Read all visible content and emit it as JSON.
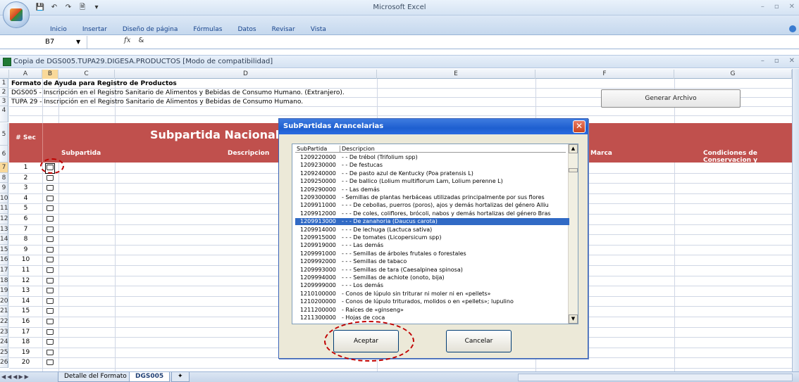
{
  "app_title": "Microsoft Excel",
  "ribbon_tabs": [
    "Inicio",
    "Insertar",
    "Diseño de página",
    "Fórmulas",
    "Datos",
    "Revisar",
    "Vista"
  ],
  "formula_bar": {
    "name_box": "B7",
    "fx": "fx",
    "value": "&"
  },
  "workbook_title": "Copia de DGS005.TUPA29.DIGESA.PRODUCTOS  [Modo de compatibilidad]",
  "columns": [
    "A",
    "B",
    "C",
    "D",
    "E",
    "F",
    "G"
  ],
  "rows": {
    "r1": "Formato de Ayuda para Registro de Productos",
    "r2": "DGS005 - Inscripción en el Registro Sanitario de Alimentos y Bebidas de Consumo Humano. (Extranjero).",
    "r3": "TUPA 29 - Inscripción en el Registro Sanitario de Alimentos y Bebidas de Consumo Humano."
  },
  "generate_button": "Generar Archivo",
  "table_header": {
    "sec": "# Sec",
    "main_title": "Subpartida Nacional",
    "subpartida": "Subpartida",
    "descripcion": "Descripcion",
    "marca": "Marca",
    "condiciones": "Condiciones de Conservacion y"
  },
  "row_numbers": [
    "1",
    "2",
    "3",
    "4",
    "5",
    "6",
    "7",
    "8",
    "9",
    "10",
    "11",
    "12",
    "13",
    "14",
    "15",
    "16",
    "17",
    "18",
    "19",
    "20",
    "21",
    "22",
    "23",
    "24",
    "25",
    "26"
  ],
  "sec_numbers": [
    "1",
    "2",
    "3",
    "4",
    "5",
    "6",
    "7",
    "8",
    "9",
    "10",
    "11",
    "12",
    "13",
    "14",
    "15",
    "16",
    "17",
    "18",
    "19",
    "20"
  ],
  "dialog": {
    "title": "SubPartidas Arancelarias",
    "col_subpartida": "SubPartida",
    "col_descripcion": "Descripcion",
    "items": [
      {
        "code": "1209220000",
        "desc": "- - De trébol (Trifolium spp)"
      },
      {
        "code": "1209230000",
        "desc": "- - De festucas"
      },
      {
        "code": "1209240000",
        "desc": "- - De pasto azul de Kentucky (Poa pratensis L)"
      },
      {
        "code": "1209250000",
        "desc": "- - De ballico (Lolium multiflorum Lam, Lolium perenne L)"
      },
      {
        "code": "1209290000",
        "desc": "- - Las demás"
      },
      {
        "code": "1209300000",
        "desc": "- Semillas de plantas herbáceas utilizadas principalmente por sus flores"
      },
      {
        "code": "1209911000",
        "desc": "- - - De cebollas, puerros (poros), ajos y demás hortalizas del género Alliu"
      },
      {
        "code": "1209912000",
        "desc": "- - - De coles, coliflores, brócoli, nabos y demás hortalizas del género Bras"
      },
      {
        "code": "1209913000",
        "desc": "- - - De zanahoria (Daucus carota)"
      },
      {
        "code": "1209914000",
        "desc": "- - - De lechuga (Lactuca sativa)"
      },
      {
        "code": "1209915000",
        "desc": "- - - De tomates (Licopersicum spp)"
      },
      {
        "code": "1209919000",
        "desc": "- - - Las demás"
      },
      {
        "code": "1209991000",
        "desc": "- - - Semillas de árboles frutales o forestales"
      },
      {
        "code": "1209992000",
        "desc": "- - - Semillas de tabaco"
      },
      {
        "code": "1209993000",
        "desc": "- - - Semillas de tara (Caesalpinea spinosa)"
      },
      {
        "code": "1209994000",
        "desc": "- - - Semillas de achiote (onoto, bija)"
      },
      {
        "code": "1209999000",
        "desc": "- - - Los demás"
      },
      {
        "code": "1210100000",
        "desc": "- Conos de lúpulo sin triturar ni moler ni en «pellets»"
      },
      {
        "code": "1210200000",
        "desc": "- Conos de lúpulo triturados, molidos o en «pellets»; lupulino"
      },
      {
        "code": "1211200000",
        "desc": "- Raíces de «ginseng»"
      },
      {
        "code": "1211300000",
        "desc": "- Hojas de coca"
      }
    ],
    "selected_index": 8,
    "accept": "Aceptar",
    "cancel": "Cancelar"
  },
  "sheet_tabs": [
    "Detalle del Formato",
    "DGS005"
  ]
}
